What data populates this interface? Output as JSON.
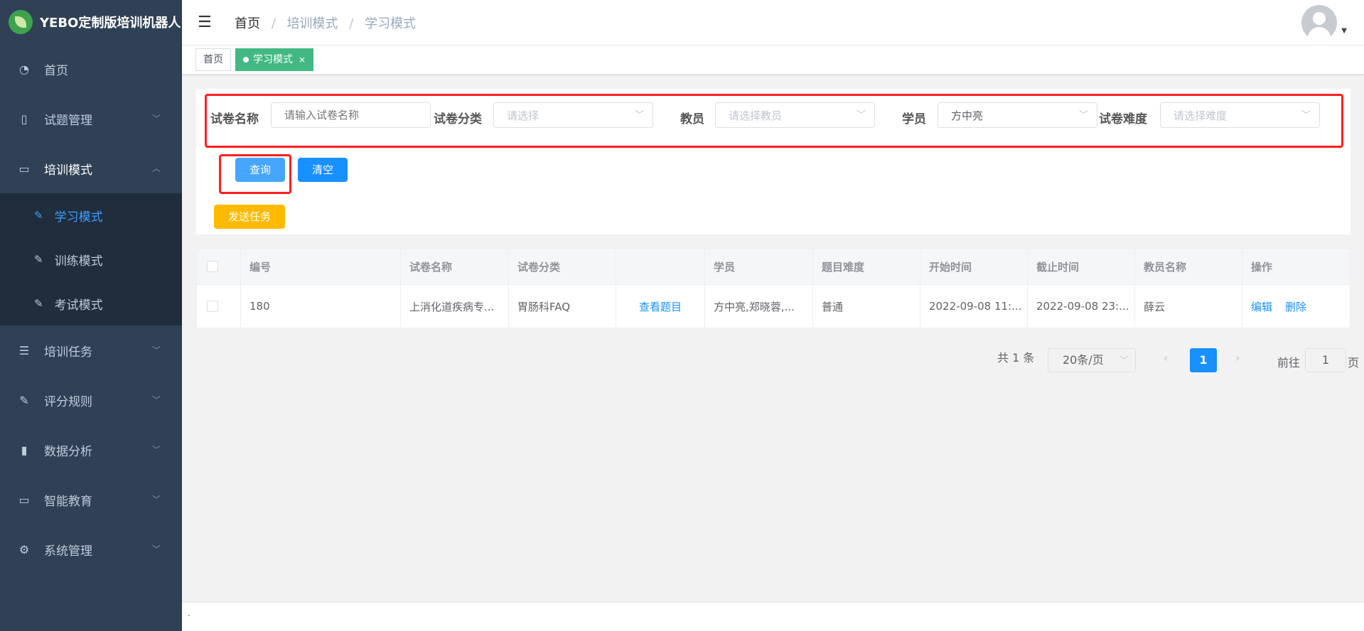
{
  "sidebar": {
    "title": "YEBO定制版培训机器人",
    "items": [
      {
        "label": "首页"
      },
      {
        "label": "试题管理"
      },
      {
        "label": "培训模式"
      },
      {
        "label": "学习模式"
      },
      {
        "label": "训练模式"
      },
      {
        "label": "考试模式"
      },
      {
        "label": "培训任务"
      },
      {
        "label": "评分规则"
      },
      {
        "label": "数据分析"
      },
      {
        "label": "智能教育"
      },
      {
        "label": "系统管理"
      }
    ]
  },
  "breadcrumb": [
    "首页",
    "培训模式",
    "学习模式"
  ],
  "tags": [
    {
      "label": "首页"
    },
    {
      "label": "学习模式"
    }
  ],
  "filters": {
    "paper_name_label": "试卷名称",
    "paper_name_placeholder": "请输入试卷名称",
    "paper_category_label": "试卷分类",
    "paper_category_placeholder": "请选择",
    "teacher_label": "教员",
    "teacher_placeholder": "请选择教员",
    "student_label": "学员",
    "student_value": "方中亮",
    "difficulty_label": "试卷难度",
    "difficulty_placeholder": "请选择难度"
  },
  "buttons": {
    "query": "查询",
    "clear": "清空",
    "send_task": "发送任务"
  },
  "table": {
    "headers": [
      "编号",
      "试卷名称",
      "试卷分类",
      "",
      "学员",
      "题目难度",
      "开始时间",
      "截止时间",
      "教员名称",
      "操作"
    ],
    "rows": [
      {
        "id": "180",
        "paper_name": "上消化道疾病专...",
        "category": "胃肠科FAQ",
        "view": "查看题目",
        "students": "方中亮,郑晓蓉,...",
        "difficulty": "普通",
        "start": "2022-09-08 11:...",
        "end": "2022-09-08 23:...",
        "teacher": "薛云",
        "edit": "编辑",
        "delete": "删除"
      }
    ]
  },
  "pagination": {
    "total": "共 1 条",
    "page_size": "20条/页",
    "current": "1",
    "goto_label": "前往",
    "goto_value": "1",
    "page_suffix": "页"
  },
  "footer": {
    "text": "."
  }
}
